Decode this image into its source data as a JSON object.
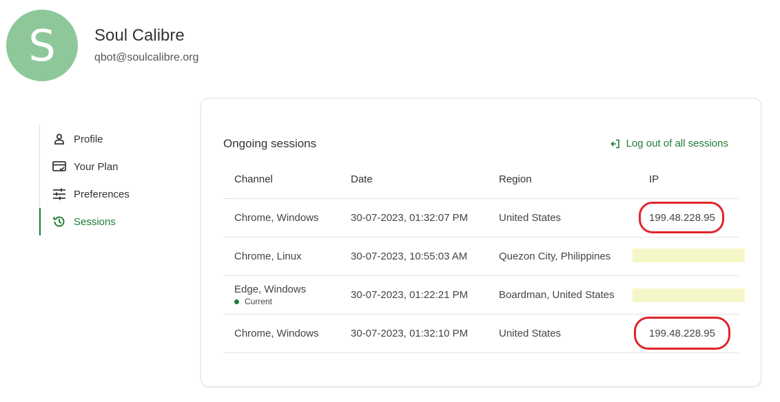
{
  "user": {
    "avatar_letter": "S",
    "name": "Soul Calibre",
    "email": "qbot@soulcalibre.org"
  },
  "sidebar": {
    "items": [
      {
        "label": "Profile",
        "icon": "person-icon",
        "active": false
      },
      {
        "label": "Your Plan",
        "icon": "credit-card-icon",
        "active": false
      },
      {
        "label": "Preferences",
        "icon": "sliders-icon",
        "active": false
      },
      {
        "label": "Sessions",
        "icon": "history-icon",
        "active": true
      }
    ]
  },
  "sessions": {
    "title": "Ongoing sessions",
    "logout_all_label": "Log out of all sessions",
    "columns": [
      "Channel",
      "Date",
      "Region",
      "IP"
    ],
    "rows": [
      {
        "channel": "Chrome, Windows",
        "current": "",
        "date": "30-07-2023, 01:32:07 PM",
        "region": "United States",
        "ip": "199.48.228.95"
      },
      {
        "channel": "Chrome, Linux",
        "current": "",
        "date": "30-07-2023, 10:55:03 AM",
        "region": "Quezon City, Philippines",
        "ip": ""
      },
      {
        "channel": "Edge, Windows",
        "current": "Current",
        "date": "30-07-2023, 01:22:21 PM",
        "region": "Boardman, United States",
        "ip": ""
      },
      {
        "channel": "Chrome, Windows",
        "current": "",
        "date": "30-07-2023, 01:32:10 PM",
        "region": "United States",
        "ip": "199.48.228.95"
      }
    ]
  },
  "colors": {
    "accent": "#1e7b34",
    "avatar": "#8ec89a",
    "annotation": "#e0232a",
    "redaction": "#f5f7c8"
  }
}
